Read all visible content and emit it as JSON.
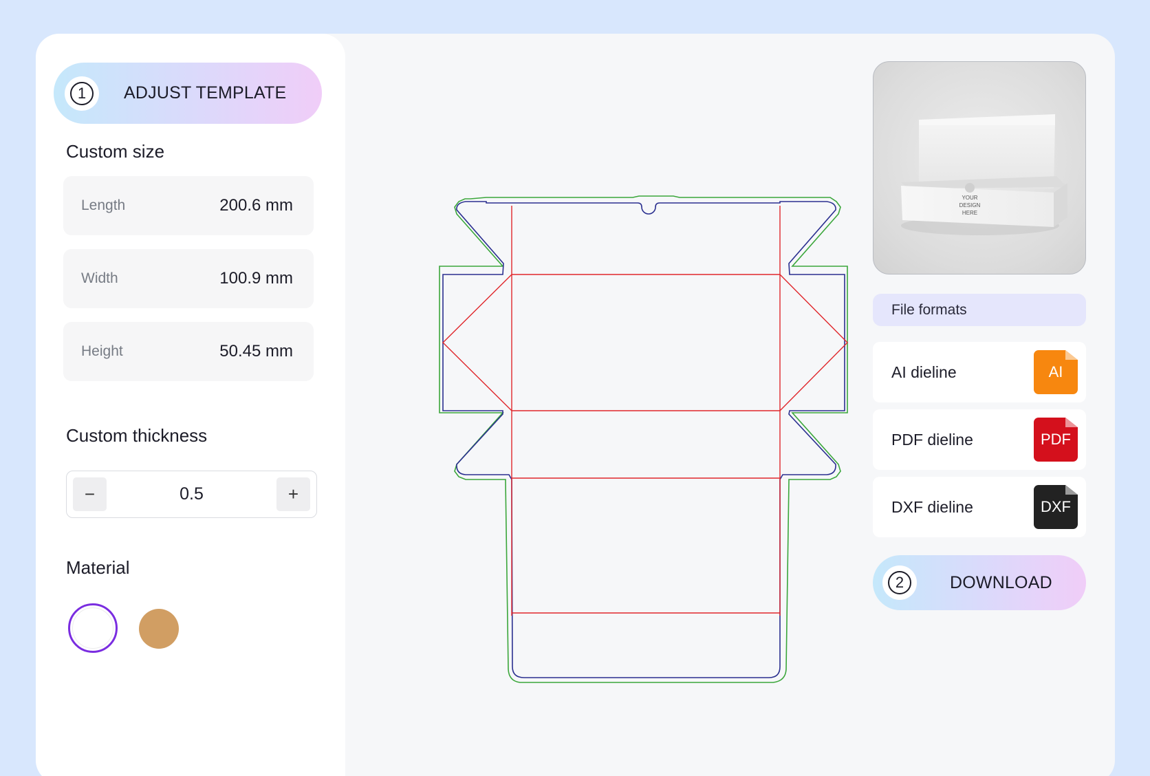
{
  "adjust_step": {
    "number": "1",
    "label": "ADJUST TEMPLATE"
  },
  "custom_size": {
    "title": "Custom size",
    "rows": [
      {
        "label": "Length",
        "value": "200.6 mm"
      },
      {
        "label": "Width",
        "value": "100.9 mm"
      },
      {
        "label": "Height",
        "value": "50.45 mm"
      }
    ]
  },
  "thickness": {
    "title": "Custom thickness",
    "value": "0.5",
    "minus": "−",
    "plus": "+"
  },
  "material": {
    "title": "Material",
    "swatches": [
      {
        "name": "white",
        "color": "#ffffff",
        "selected": true
      },
      {
        "name": "kraft",
        "color": "#d19e63",
        "selected": false
      }
    ]
  },
  "preview": {
    "box_text": [
      "YOUR",
      "DESIGN",
      "HERE"
    ]
  },
  "file_formats": {
    "title": "File formats",
    "items": [
      {
        "label": "AI dieline",
        "icon_text": "AI",
        "color": "#f7870f"
      },
      {
        "label": "PDF dieline",
        "icon_text": "PDF",
        "color": "#d4101c"
      },
      {
        "label": "DXF dieline",
        "icon_text": "DXF",
        "color": "#222222"
      }
    ]
  },
  "download_step": {
    "number": "2",
    "label": "DOWNLOAD"
  },
  "colors": {
    "accent_purple": "#7a2de0",
    "cut_line": "#2a2f8f",
    "fold_line": "#e0262b",
    "bleed_line": "#3aa63a",
    "background": "#d8e7fd"
  }
}
